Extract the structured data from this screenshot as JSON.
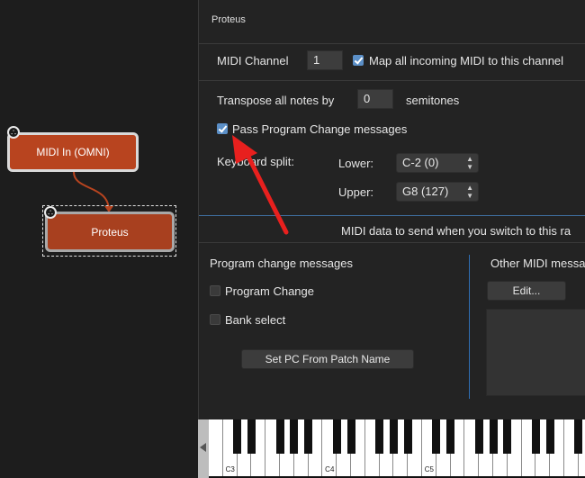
{
  "graph": {
    "nodes": [
      {
        "label": "MIDI In (OMNI)",
        "icon": "midi-din-icon"
      },
      {
        "label": "Proteus",
        "icon": "midi-din-icon"
      }
    ]
  },
  "panel": {
    "title": "Proteus",
    "midi_channel_label": "MIDI Channel",
    "midi_channel_value": "1",
    "map_all_label": "Map all incoming MIDI to this channel",
    "map_all_checked": true,
    "transpose_label": "Transpose all notes by",
    "transpose_value": "0",
    "semitones_label": "semitones",
    "pass_pc_label": "Pass Program Change messages",
    "pass_pc_checked": true,
    "keyboard_split_label": "Keyboard split:",
    "lower_label": "Lower:",
    "lower_value": "C-2 (0)",
    "upper_label": "Upper:",
    "upper_value": "G8 (127)",
    "banner_text": "MIDI data to send when you switch to this ra",
    "program_change_section": "Program change messages",
    "program_change_label": "Program Change",
    "bank_select_label": "Bank select",
    "set_pc_button": "Set PC From Patch Name",
    "other_midi_section": "Other MIDI messa",
    "edit_button": "Edit..."
  },
  "keyboard": {
    "labels": [
      "C3",
      "C4",
      "C5"
    ]
  },
  "colors": {
    "accent": "#5b8fc7",
    "node_fill": "#b8441f",
    "annotation_arrow": "#e8201e"
  }
}
